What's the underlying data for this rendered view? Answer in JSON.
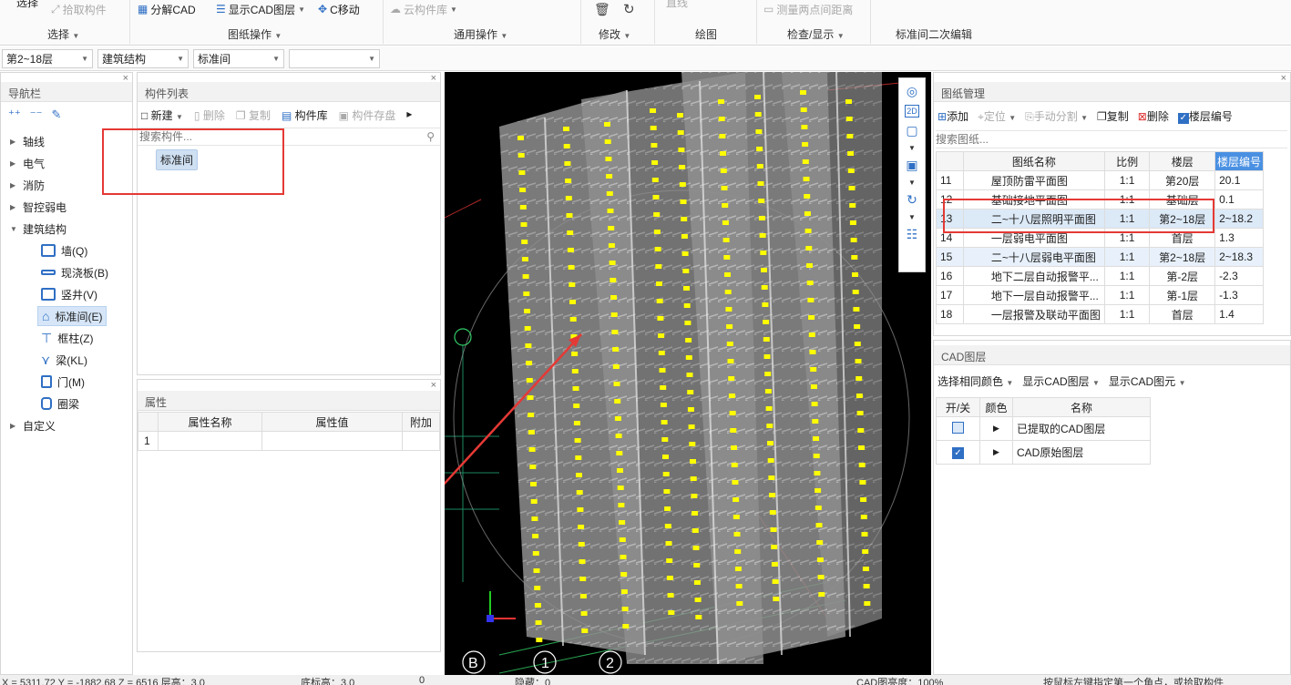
{
  "ribbon": {
    "items": {
      "select": "选择",
      "pick": "拾取构件",
      "split_cad": "分解CAD",
      "show_cad_layer": "显示CAD图层",
      "c_move": "C移动",
      "cloud_lib": "云构件库",
      "line": "直线",
      "measure": "测量两点间距离"
    },
    "groups": [
      "选择",
      "图纸操作",
      "通用操作",
      "修改",
      "绘图",
      "检查/显示",
      "标准间二次编辑"
    ]
  },
  "selectors": [
    "第2~18层",
    "建筑结构",
    "标准间",
    ""
  ],
  "nav": {
    "title": "导航栏",
    "items": [
      "轴线",
      "电气",
      "消防",
      "智控弱电",
      "建筑结构"
    ],
    "sub_items": [
      "墙(Q)",
      "现浇板(B)",
      "竖井(V)",
      "标准间(E)",
      "框柱(Z)",
      "梁(KL)",
      "门(M)",
      "圈梁"
    ],
    "last": "自定义"
  },
  "component_list": {
    "title": "构件列表",
    "toolbar": [
      "新建",
      "删除",
      "复制",
      "构件库",
      "构件存盘"
    ],
    "search_placeholder": "搜索构件...",
    "selected": "标准间"
  },
  "properties": {
    "title": "属性",
    "headers": [
      "属性名称",
      "属性值",
      "附加"
    ],
    "rows": [
      [
        "1",
        "",
        "",
        ""
      ]
    ]
  },
  "drawing_mgmt": {
    "title": "图纸管理",
    "toolbar": [
      "添加",
      "定位",
      "手动分割",
      "复制",
      "删除",
      "楼层编号"
    ],
    "search_placeholder": "搜索图纸...",
    "headers": [
      "",
      "图纸名称",
      "比例",
      "楼层",
      "楼层编号"
    ],
    "rows": [
      [
        "11",
        "屋顶防雷平面图",
        "1:1",
        "第20层",
        "20.1"
      ],
      [
        "12",
        "基础接地平面图",
        "1:1",
        "基础层",
        "0.1"
      ],
      [
        "13",
        "二~十八层照明平面图",
        "1:1",
        "第2~18层",
        "2~18.2"
      ],
      [
        "14",
        "一层弱电平面图",
        "1:1",
        "首层",
        "1.3"
      ],
      [
        "15",
        "二~十八层弱电平面图",
        "1:1",
        "第2~18层",
        "2~18.3"
      ],
      [
        "16",
        "地下二层自动报警平...",
        "1:1",
        "第-2层",
        "-2.3"
      ],
      [
        "17",
        "地下一层自动报警平...",
        "1:1",
        "第-1层",
        "-1.3"
      ],
      [
        "18",
        "一层报警及联动平面图",
        "1:1",
        "首层",
        "1.4"
      ]
    ]
  },
  "cad_layer": {
    "title": "CAD图层",
    "toolbar": [
      "选择相同颜色",
      "显示CAD图层",
      "显示CAD图元"
    ],
    "headers": [
      "开/关",
      "颜色",
      "名称"
    ],
    "rows": [
      "已提取的CAD图层",
      "CAD原始图层"
    ]
  },
  "viewport": {
    "axis_labels": [
      "B",
      "1",
      "2"
    ],
    "view_2d": "2D"
  },
  "status": {
    "coords": "X = 5311.72 Y = -1882.68 Z = 6516 层高：3.0",
    "base": "底标高：3.0",
    "zero": "0",
    "hidden": "隐藏：0",
    "cad_brightness": "CAD图亮度：100%",
    "hint": "按鼠标左键指定第一个角点，或拾取构件"
  },
  "colors": {
    "accent": "#2f6fc4",
    "highlight": "#e53935",
    "selected_row": "#dce9f7"
  }
}
